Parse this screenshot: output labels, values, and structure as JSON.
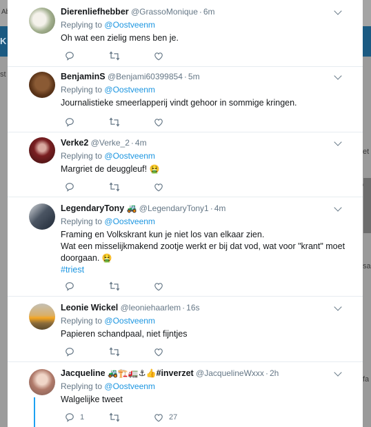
{
  "background": {
    "top_left": "Ab",
    "blue_left": "K",
    "left_fragment": "st",
    "right_fragments": [
      "et w",
      "eze",
      "sa",
      "fa"
    ]
  },
  "tweets": [
    {
      "username": "Dierenliefhebber",
      "handle": "@GrassoMonique",
      "time": "6m",
      "replying_prefix": "Replying to",
      "replying_to": "@Oostveenm",
      "text_lines": [
        "Oh wat een zielig mens ben je."
      ]
    },
    {
      "username": "BenjaminS",
      "handle": "@Benjami60399854",
      "time": "5m",
      "replying_prefix": "Replying to",
      "replying_to": "@Oostveenm",
      "text_lines": [
        "Journalistieke smeerlapperij vindt gehoor in sommige kringen."
      ]
    },
    {
      "username": "Verke2",
      "handle": "@Verke_2",
      "time": "4m",
      "replying_prefix": "Replying to",
      "replying_to": "@Oostveenm",
      "text_lines": [
        "Margriet de deuggleuf!"
      ],
      "text_emoji": "🤮"
    },
    {
      "username": "LegendaryTony",
      "name_emoji": "🚜",
      "handle": "@LegendaryTony1",
      "time": "4m",
      "replying_prefix": "Replying to",
      "replying_to": "@Oostveenm",
      "text_lines": [
        "Framing en Volkskrant kun je niet los van elkaar zien.",
        "Wat een misselijkmakend zootje werkt er bij dat vod, wat voor \"krant\" moet",
        "doorgaan."
      ],
      "text_emoji": "🤮",
      "hashtag": "#triest"
    },
    {
      "username": "Leonie Wickel",
      "handle": "@leoniehaarlem",
      "time": "16s",
      "replying_prefix": "Replying to",
      "replying_to": "@Oostveenm",
      "text_lines": [
        "Papieren schandpaal, niet fijntjes"
      ]
    },
    {
      "username": "Jacqueline",
      "name_emoji": "🚜🏗️🚛⚓👍",
      "name_tag": "#inverzet",
      "handle": "@JacquelineWxxx",
      "time": "2h",
      "replying_prefix": "Replying to",
      "replying_to": "@Oostveenm",
      "text_lines": [
        "Walgelijke tweet"
      ],
      "reply_count": "1",
      "like_count": "27"
    }
  ],
  "separator": "·",
  "icons": {
    "reply": "reply-icon",
    "retweet": "retweet-icon",
    "like": "heart-icon",
    "caret": "chevron-down-icon"
  },
  "colors": {
    "link": "#1b95e0",
    "secondary": "#657786",
    "thread": "#1da1f2",
    "overlay_blue": "#1b5a82"
  }
}
